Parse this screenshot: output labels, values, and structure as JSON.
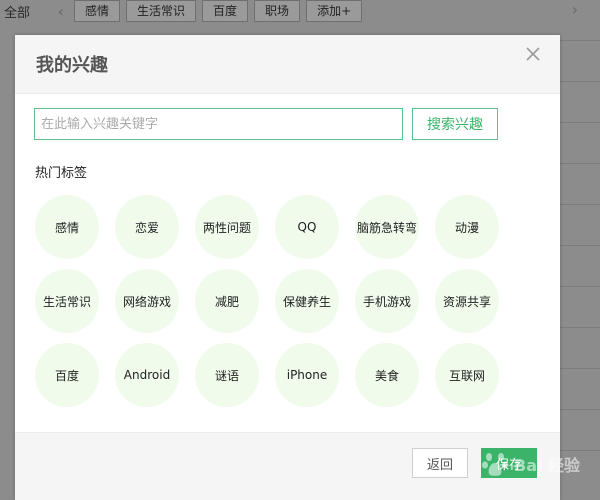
{
  "background": {
    "all_label": "全部",
    "tags": [
      "感情",
      "生活常识",
      "百度",
      "职场",
      "添加+"
    ]
  },
  "modal": {
    "title": "我的兴趣",
    "search": {
      "placeholder": "在此输入兴趣关键字",
      "button_label": "搜索兴趣"
    },
    "hot_label": "热门标签",
    "hot_tags": [
      "感情",
      "恋爱",
      "两性问题",
      "QQ",
      "脑筋急转弯",
      "动漫",
      "生活常识",
      "网络游戏",
      "减肥",
      "保健养生",
      "手机游戏",
      "资源共享",
      "百度",
      "Android",
      "谜语",
      "iPhone",
      "美食",
      "互联网"
    ],
    "footer": {
      "back_label": "返回",
      "confirm_label": "保存"
    }
  },
  "watermark": {
    "text": "Bai 经验"
  },
  "colors": {
    "accent": "#3bb46a",
    "tag_bg": "#f0fbec"
  }
}
